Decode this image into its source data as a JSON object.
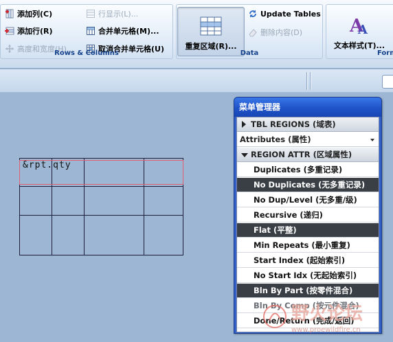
{
  "ribbon": {
    "rows_columns": {
      "add_column": "添加列(C)",
      "add_row": "添加行(R)",
      "height_width": "高度和宽度(H)...",
      "row_display": "行显示(L)...",
      "merge_cells": "合并单元格(M)...",
      "unmerge_cells": "取消合并单元格(U)",
      "group_label": "Rows & Columns"
    },
    "data": {
      "repeat_region": "重复区域(R)...",
      "update_tables": "Update Tables",
      "delete_content": "删除内容(D)",
      "group_label": "Data"
    },
    "format": {
      "text_style": "文本样式(T)...",
      "group_label": "Form"
    }
  },
  "table": {
    "cell_text": "&rpt.qty"
  },
  "menu_manager": {
    "title": "菜单管理器",
    "items": [
      {
        "label": "TBL REGIONS (域表)",
        "kind": "header",
        "expanded": false
      },
      {
        "label": "Attributes (属性)",
        "kind": "dropdown"
      },
      {
        "label": "REGION ATTR (区域属性)",
        "kind": "header",
        "expanded": true
      },
      {
        "label": "Duplicates (多重记录)",
        "kind": "option",
        "selected": false
      },
      {
        "label": "No Duplicates (无多重记录)",
        "kind": "option",
        "selected": true
      },
      {
        "label": "No Dup/Level (无多重/级)",
        "kind": "option",
        "selected": false
      },
      {
        "label": "Recursive (递归)",
        "kind": "option",
        "selected": false
      },
      {
        "label": "Flat (平整)",
        "kind": "option",
        "selected": true
      },
      {
        "label": "Min Repeats (最小重复)",
        "kind": "option",
        "selected": false
      },
      {
        "label": "Start Index (起始索引)",
        "kind": "option",
        "selected": false
      },
      {
        "label": "No Start Idx (无起始索引)",
        "kind": "option",
        "selected": false
      },
      {
        "label": "Bln By Part (按零件混合)",
        "kind": "option",
        "selected": true
      },
      {
        "label": "Bln By Comp (按元件混合)",
        "kind": "option",
        "selected": false
      },
      {
        "label": "Done/Return (完成/返回)",
        "kind": "option",
        "selected": false
      }
    ]
  },
  "watermark": {
    "cn": "野火论坛",
    "url": "www.proewildfire.cn"
  },
  "colors": {
    "canvas": "#9cb6d3",
    "menu_title": "#2a5fd6",
    "selected_item": "#3a3f45",
    "region_outline": "#e06070",
    "ribbon_group_label": "#15428b"
  }
}
